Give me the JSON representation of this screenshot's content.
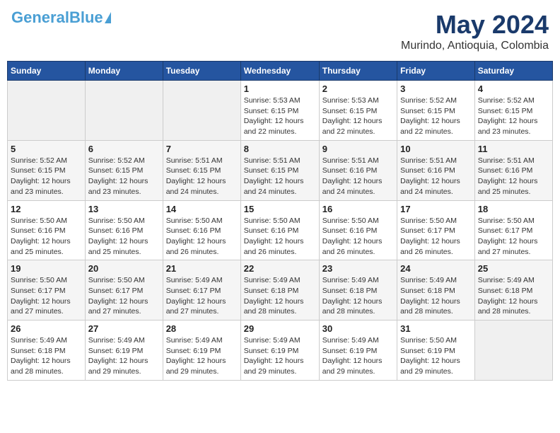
{
  "logo": {
    "part1": "General",
    "part2": "Blue"
  },
  "title": "May 2024",
  "subtitle": "Murindo, Antioquia, Colombia",
  "weekdays": [
    "Sunday",
    "Monday",
    "Tuesday",
    "Wednesday",
    "Thursday",
    "Friday",
    "Saturday"
  ],
  "weeks": [
    [
      {
        "day": "",
        "info": ""
      },
      {
        "day": "",
        "info": ""
      },
      {
        "day": "",
        "info": ""
      },
      {
        "day": "1",
        "info": "Sunrise: 5:53 AM\nSunset: 6:15 PM\nDaylight: 12 hours\nand 22 minutes."
      },
      {
        "day": "2",
        "info": "Sunrise: 5:53 AM\nSunset: 6:15 PM\nDaylight: 12 hours\nand 22 minutes."
      },
      {
        "day": "3",
        "info": "Sunrise: 5:52 AM\nSunset: 6:15 PM\nDaylight: 12 hours\nand 22 minutes."
      },
      {
        "day": "4",
        "info": "Sunrise: 5:52 AM\nSunset: 6:15 PM\nDaylight: 12 hours\nand 23 minutes."
      }
    ],
    [
      {
        "day": "5",
        "info": "Sunrise: 5:52 AM\nSunset: 6:15 PM\nDaylight: 12 hours\nand 23 minutes."
      },
      {
        "day": "6",
        "info": "Sunrise: 5:52 AM\nSunset: 6:15 PM\nDaylight: 12 hours\nand 23 minutes."
      },
      {
        "day": "7",
        "info": "Sunrise: 5:51 AM\nSunset: 6:15 PM\nDaylight: 12 hours\nand 24 minutes."
      },
      {
        "day": "8",
        "info": "Sunrise: 5:51 AM\nSunset: 6:15 PM\nDaylight: 12 hours\nand 24 minutes."
      },
      {
        "day": "9",
        "info": "Sunrise: 5:51 AM\nSunset: 6:16 PM\nDaylight: 12 hours\nand 24 minutes."
      },
      {
        "day": "10",
        "info": "Sunrise: 5:51 AM\nSunset: 6:16 PM\nDaylight: 12 hours\nand 24 minutes."
      },
      {
        "day": "11",
        "info": "Sunrise: 5:51 AM\nSunset: 6:16 PM\nDaylight: 12 hours\nand 25 minutes."
      }
    ],
    [
      {
        "day": "12",
        "info": "Sunrise: 5:50 AM\nSunset: 6:16 PM\nDaylight: 12 hours\nand 25 minutes."
      },
      {
        "day": "13",
        "info": "Sunrise: 5:50 AM\nSunset: 6:16 PM\nDaylight: 12 hours\nand 25 minutes."
      },
      {
        "day": "14",
        "info": "Sunrise: 5:50 AM\nSunset: 6:16 PM\nDaylight: 12 hours\nand 26 minutes."
      },
      {
        "day": "15",
        "info": "Sunrise: 5:50 AM\nSunset: 6:16 PM\nDaylight: 12 hours\nand 26 minutes."
      },
      {
        "day": "16",
        "info": "Sunrise: 5:50 AM\nSunset: 6:16 PM\nDaylight: 12 hours\nand 26 minutes."
      },
      {
        "day": "17",
        "info": "Sunrise: 5:50 AM\nSunset: 6:17 PM\nDaylight: 12 hours\nand 26 minutes."
      },
      {
        "day": "18",
        "info": "Sunrise: 5:50 AM\nSunset: 6:17 PM\nDaylight: 12 hours\nand 27 minutes."
      }
    ],
    [
      {
        "day": "19",
        "info": "Sunrise: 5:50 AM\nSunset: 6:17 PM\nDaylight: 12 hours\nand 27 minutes."
      },
      {
        "day": "20",
        "info": "Sunrise: 5:50 AM\nSunset: 6:17 PM\nDaylight: 12 hours\nand 27 minutes."
      },
      {
        "day": "21",
        "info": "Sunrise: 5:49 AM\nSunset: 6:17 PM\nDaylight: 12 hours\nand 27 minutes."
      },
      {
        "day": "22",
        "info": "Sunrise: 5:49 AM\nSunset: 6:18 PM\nDaylight: 12 hours\nand 28 minutes."
      },
      {
        "day": "23",
        "info": "Sunrise: 5:49 AM\nSunset: 6:18 PM\nDaylight: 12 hours\nand 28 minutes."
      },
      {
        "day": "24",
        "info": "Sunrise: 5:49 AM\nSunset: 6:18 PM\nDaylight: 12 hours\nand 28 minutes."
      },
      {
        "day": "25",
        "info": "Sunrise: 5:49 AM\nSunset: 6:18 PM\nDaylight: 12 hours\nand 28 minutes."
      }
    ],
    [
      {
        "day": "26",
        "info": "Sunrise: 5:49 AM\nSunset: 6:18 PM\nDaylight: 12 hours\nand 28 minutes."
      },
      {
        "day": "27",
        "info": "Sunrise: 5:49 AM\nSunset: 6:19 PM\nDaylight: 12 hours\nand 29 minutes."
      },
      {
        "day": "28",
        "info": "Sunrise: 5:49 AM\nSunset: 6:19 PM\nDaylight: 12 hours\nand 29 minutes."
      },
      {
        "day": "29",
        "info": "Sunrise: 5:49 AM\nSunset: 6:19 PM\nDaylight: 12 hours\nand 29 minutes."
      },
      {
        "day": "30",
        "info": "Sunrise: 5:49 AM\nSunset: 6:19 PM\nDaylight: 12 hours\nand 29 minutes."
      },
      {
        "day": "31",
        "info": "Sunrise: 5:50 AM\nSunset: 6:19 PM\nDaylight: 12 hours\nand 29 minutes."
      },
      {
        "day": "",
        "info": ""
      }
    ]
  ]
}
